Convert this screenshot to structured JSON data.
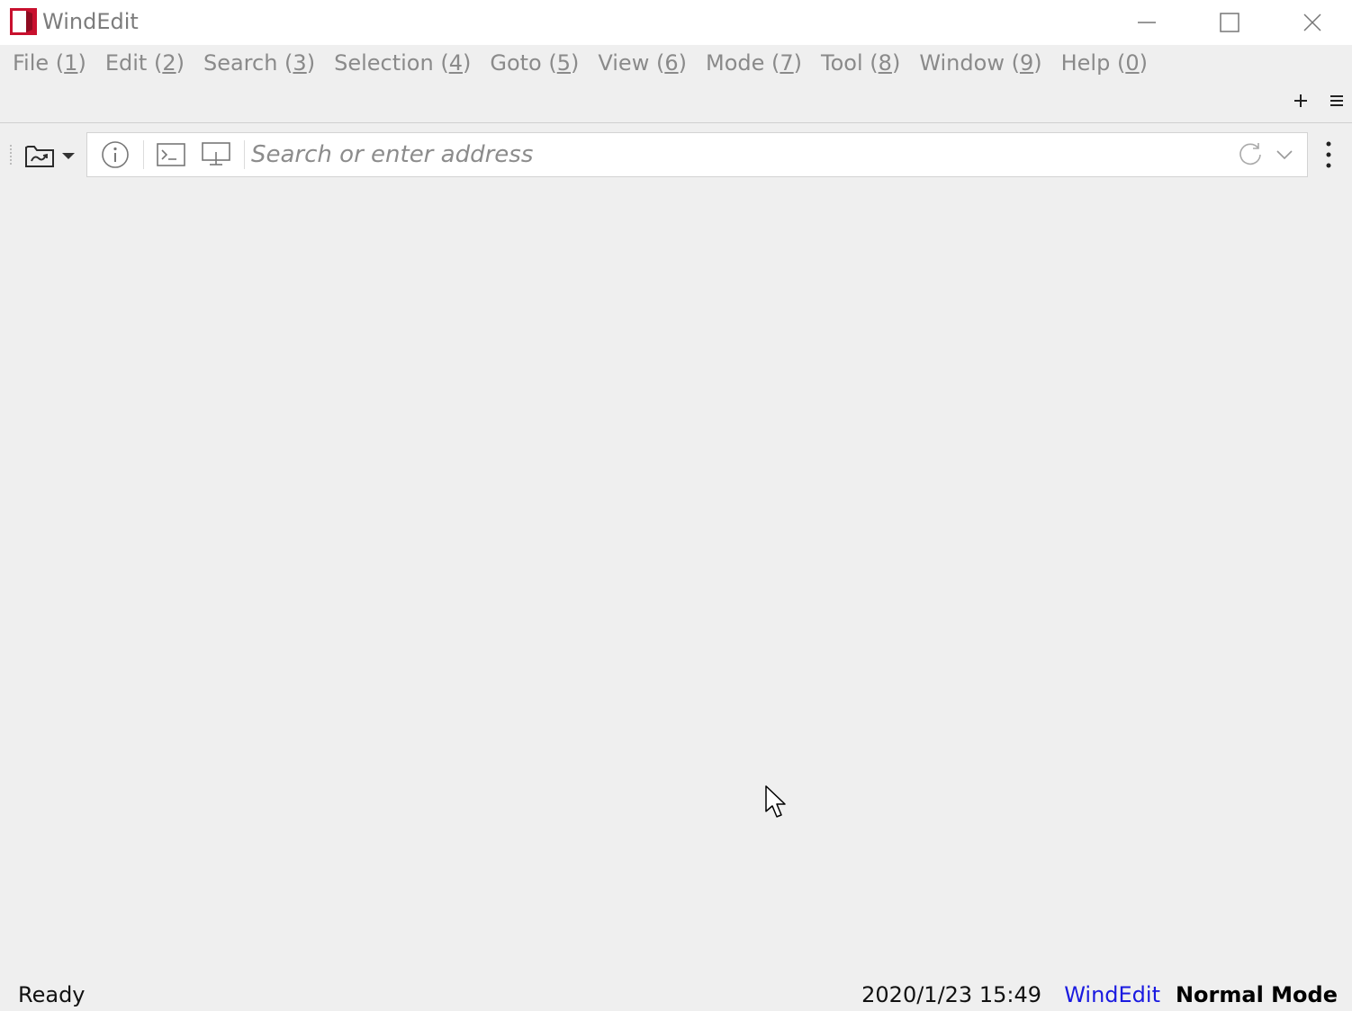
{
  "window": {
    "title": "WindEdit",
    "brand_color": "#c8102e"
  },
  "menu": [
    {
      "name": "File",
      "key": "1"
    },
    {
      "name": "Edit",
      "key": "2"
    },
    {
      "name": "Search",
      "key": "3"
    },
    {
      "name": "Selection",
      "key": "4"
    },
    {
      "name": "Goto",
      "key": "5"
    },
    {
      "name": "View",
      "key": "6"
    },
    {
      "name": "Mode",
      "key": "7"
    },
    {
      "name": "Tool",
      "key": "8"
    },
    {
      "name": "Window",
      "key": "9"
    },
    {
      "name": "Help",
      "key": "0"
    }
  ],
  "tabstrip": {
    "add_icon": "plus-icon",
    "menu_icon": "hamburger-icon"
  },
  "toolbar": {
    "folder_icon": "folder-refresh-icon",
    "info_icon": "info-icon",
    "terminal_icon": "terminal-icon",
    "remote_icon": "monitor-icon",
    "reload_icon": "reload-icon",
    "history_icon": "chevron-down-icon",
    "more_icon": "more-vertical-icon"
  },
  "address": {
    "placeholder": "Search or enter address",
    "value": ""
  },
  "status": {
    "state": "Ready",
    "datetime": "2020/1/23 15:49",
    "app": "WindEdit",
    "mode": "Normal Mode",
    "app_color": "#1a1ae0"
  }
}
